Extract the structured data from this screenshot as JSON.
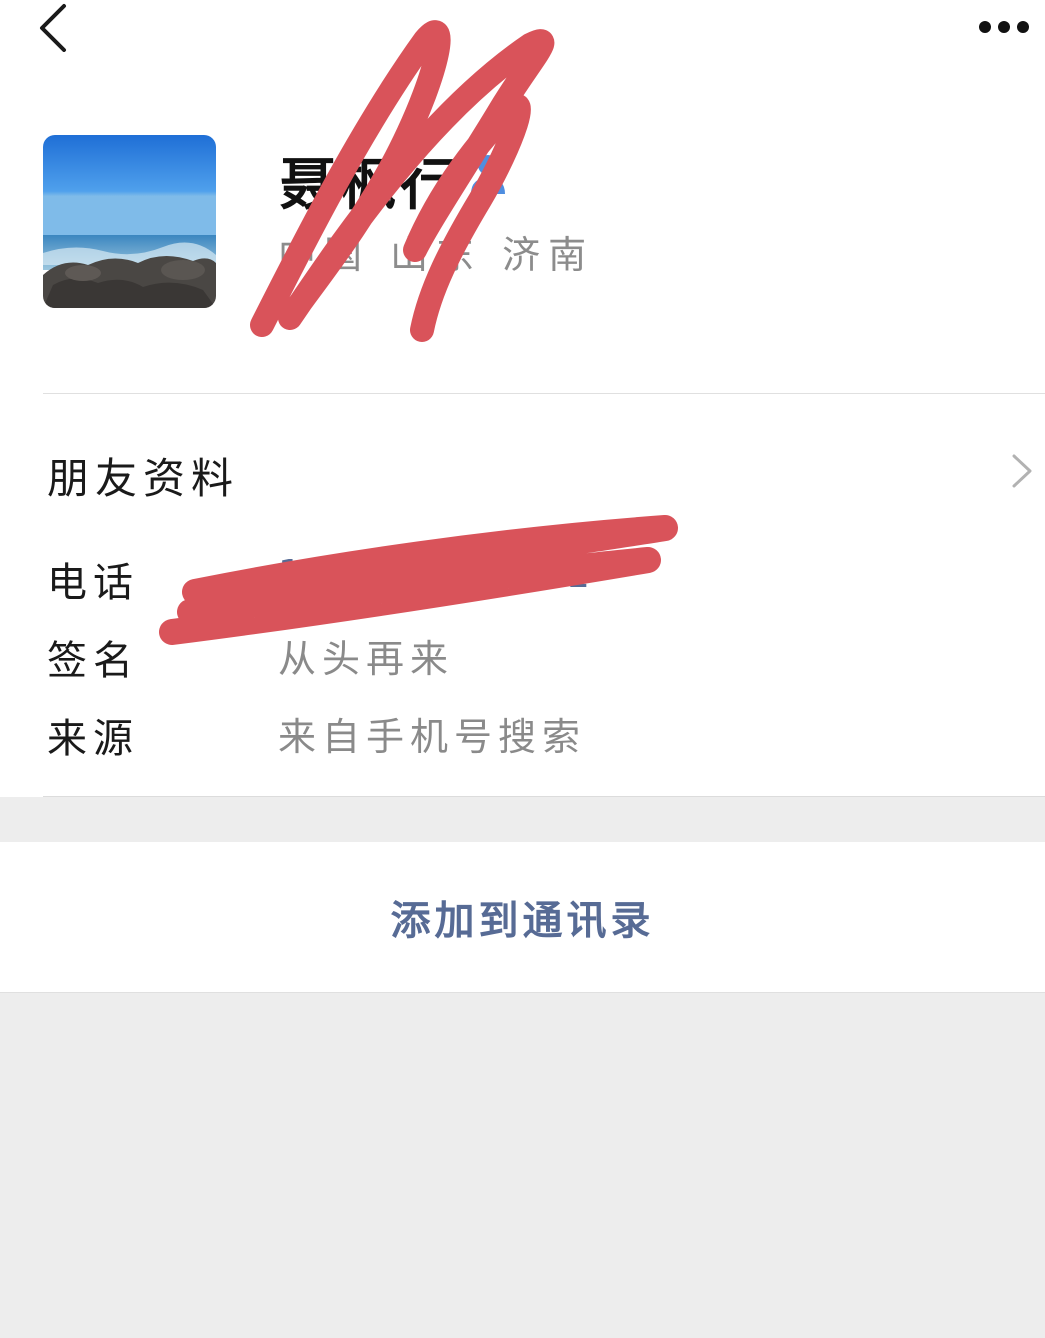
{
  "profile": {
    "name": "聂枫行",
    "region": "中国 山东 济南"
  },
  "details": {
    "section_title": "朋友资料",
    "phone_label": "电话",
    "phone_value": "17••••••••1",
    "signature_label": "签名",
    "signature_value": "从头再来",
    "source_label": "来源",
    "source_value": "来自手机号搜索"
  },
  "actions": {
    "add_to_contacts": "添加到通讯录"
  },
  "icons": {
    "back": "back-arrow-icon",
    "more": "more-dots-icon",
    "chevron": "chevron-right-icon",
    "gender": "male-gender-icon"
  },
  "colors": {
    "link_blue": "#576b95",
    "scribble_red": "#d9535a",
    "background_gray": "#ededed"
  }
}
